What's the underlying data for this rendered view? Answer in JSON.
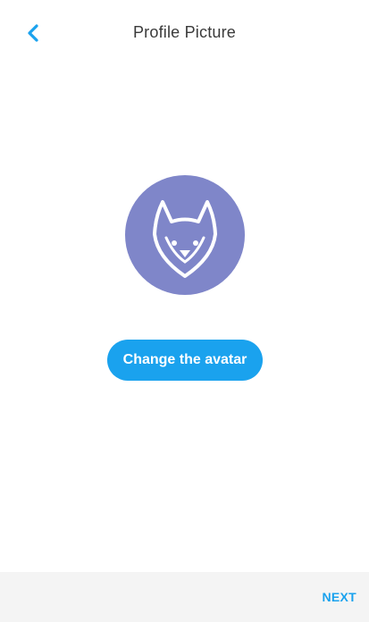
{
  "header": {
    "back_icon": "chevron-left-icon",
    "title": "Profile Picture"
  },
  "avatar": {
    "icon": "fox-icon",
    "background_color": "#7f86c9"
  },
  "actions": {
    "change_avatar_label": "Change the avatar"
  },
  "footer": {
    "next_label": "NEXT"
  },
  "colors": {
    "accent": "#1aa2ee",
    "title_text": "#3a3a3a",
    "footer_background": "#f4f4f4"
  }
}
